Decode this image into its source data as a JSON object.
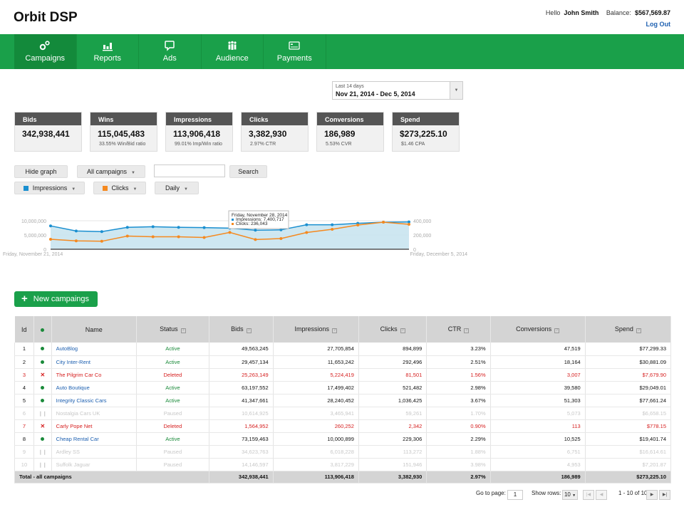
{
  "app": {
    "title": "Orbit DSP"
  },
  "user": {
    "hello": "Hello",
    "name": "John Smith",
    "balance_label": "Balance:",
    "balance": "$567,569.87",
    "logout": "Log Out"
  },
  "nav": [
    {
      "label": "Campaigns",
      "icon": "gears-icon",
      "active": true
    },
    {
      "label": "Reports",
      "icon": "bar-chart-icon"
    },
    {
      "label": "Ads",
      "icon": "speech-bubble-icon"
    },
    {
      "label": "Audience",
      "icon": "people-icon"
    },
    {
      "label": "Payments",
      "icon": "credit-card-icon"
    }
  ],
  "daterange": {
    "label": "Last 14 days",
    "value": "Nov 21, 2014 - Dec 5, 2014"
  },
  "stats": [
    {
      "title": "Bids",
      "value": "342,938,441",
      "sub": ""
    },
    {
      "title": "Wins",
      "value": "115,045,483",
      "sub": "33.55% Win/Bid ratio"
    },
    {
      "title": "Impressions",
      "value": "113,906,418",
      "sub": "99.01% Imp/Win ratio"
    },
    {
      "title": "Clicks",
      "value": "3,382,930",
      "sub": "2.97% CTR"
    },
    {
      "title": "Conversions",
      "value": "186,989",
      "sub": "5.53% CVR"
    },
    {
      "title": "Spend",
      "value": "$273,225.10",
      "sub": "$1.46 CPA"
    }
  ],
  "controls": {
    "hide_graph": "Hide graph",
    "campaign_filter": "All campaigns",
    "search_value": "",
    "search_button": "Search",
    "metric1": "Impressions",
    "metric1_color": "#1a8fd0",
    "metric2": "Clicks",
    "metric2_color": "#f5891f",
    "interval": "Daily"
  },
  "chart_data": {
    "type": "line",
    "x_start_label": "Friday, November 21, 2014",
    "x_end_label": "Friday, December 5, 2014",
    "left_axis": {
      "ticks": [
        "0",
        "5,000,000",
        "10,000,000"
      ],
      "range": [
        0,
        12000000
      ]
    },
    "right_axis": {
      "ticks": [
        "0",
        "200,000",
        "400,000"
      ],
      "range": [
        0,
        480000
      ]
    },
    "series": [
      {
        "name": "Impressions",
        "axis": "left",
        "color": "#1a8fd0",
        "values": [
          8200000,
          6400000,
          6200000,
          7700000,
          7900000,
          7700000,
          7600000,
          7400717,
          6700000,
          6800000,
          8600000,
          8600000,
          9100000,
          9500000,
          9600000
        ]
      },
      {
        "name": "Clicks",
        "axis": "right",
        "color": "#f5891f",
        "values": [
          140000,
          118000,
          112000,
          185000,
          175000,
          175000,
          165000,
          236043,
          136000,
          150000,
          235000,
          280000,
          340000,
          380000,
          350000
        ]
      }
    ],
    "tooltip": {
      "title": "Friday, November 28, 2014",
      "lines": [
        "Impressions: 7,400,717",
        "Clicks: 236,043"
      ]
    }
  },
  "new_button": "New campaings",
  "table": {
    "headers": [
      "Id",
      "●",
      "Name",
      "Status",
      "Bids",
      "Impressions",
      "Clicks",
      "CTR",
      "Conversions",
      "Spend"
    ],
    "rows": [
      {
        "id": "1",
        "state": "active",
        "name": "AutoBlog",
        "status": "Active",
        "bids": "49,563,245",
        "impressions": "27,705,854",
        "clicks": "894,899",
        "ctr": "3.23%",
        "conversions": "47,519",
        "spend": "$77,299.33"
      },
      {
        "id": "2",
        "state": "active",
        "name": "City Inter-Rent",
        "status": "Active",
        "bids": "29,457,134",
        "impressions": "11,653,242",
        "clicks": "292,496",
        "ctr": "2.51%",
        "conversions": "18,164",
        "spend": "$30,881.09"
      },
      {
        "id": "3",
        "state": "deleted",
        "name": "The Pilgrim Car Co",
        "status": "Deleted",
        "bids": "25,263,149",
        "impressions": "5,224,419",
        "clicks": "81,501",
        "ctr": "1.56%",
        "conversions": "3,007",
        "spend": "$7,679.90"
      },
      {
        "id": "4",
        "state": "active",
        "name": "Auto Boutique",
        "status": "Active",
        "bids": "63,197,552",
        "impressions": "17,499,402",
        "clicks": "521,482",
        "ctr": "2.98%",
        "conversions": "39,580",
        "spend": "$29,049.01"
      },
      {
        "id": "5",
        "state": "active",
        "name": "Integrity Classic Cars",
        "status": "Active",
        "bids": "41,347,661",
        "impressions": "28,240,452",
        "clicks": "1,036,425",
        "ctr": "3.67%",
        "conversions": "51,303",
        "spend": "$77,661.24"
      },
      {
        "id": "6",
        "state": "paused",
        "name": "Nostalgia Cars UK",
        "status": "Paused",
        "bids": "10,614,925",
        "impressions": "3,465,941",
        "clicks": "59,261",
        "ctr": "1.70%",
        "conversions": "5,073",
        "spend": "$6,658.15"
      },
      {
        "id": "7",
        "state": "deleted",
        "name": "Carly Pope Net",
        "status": "Deleted",
        "bids": "1,564,952",
        "impressions": "260,252",
        "clicks": "2,342",
        "ctr": "0.90%",
        "conversions": "113",
        "spend": "$778.15"
      },
      {
        "id": "8",
        "state": "active",
        "name": "Cheap Rental Car",
        "status": "Active",
        "bids": "73,159,463",
        "impressions": "10,000,899",
        "clicks": "229,306",
        "ctr": "2.29%",
        "conversions": "10,525",
        "spend": "$19,401.74"
      },
      {
        "id": "9",
        "state": "paused",
        "name": "Ardley SS",
        "status": "Paused",
        "bids": "34,623,763",
        "impressions": "6,018,228",
        "clicks": "113,272",
        "ctr": "1.88%",
        "conversions": "6,751",
        "spend": "$16,614.61"
      },
      {
        "id": "10",
        "state": "paused",
        "name": "Suffolk Jaguar",
        "status": "Paused",
        "bids": "14,146,597",
        "impressions": "3,817,229",
        "clicks": "151,946",
        "ctr": "3.98%",
        "conversions": "4,953",
        "spend": "$7,201.87"
      }
    ],
    "total": {
      "label": "Total - all campaigns",
      "bids": "342,938,441",
      "impressions": "113,906,418",
      "clicks": "3,382,930",
      "ctr": "2.97%",
      "conversions": "186,989",
      "spend": "$273,225.10"
    }
  },
  "pager": {
    "goto_label": "Go to page:",
    "page": "1",
    "rows_label": "Show rows:",
    "rows": "10",
    "range": "1 - 10 of 10"
  }
}
